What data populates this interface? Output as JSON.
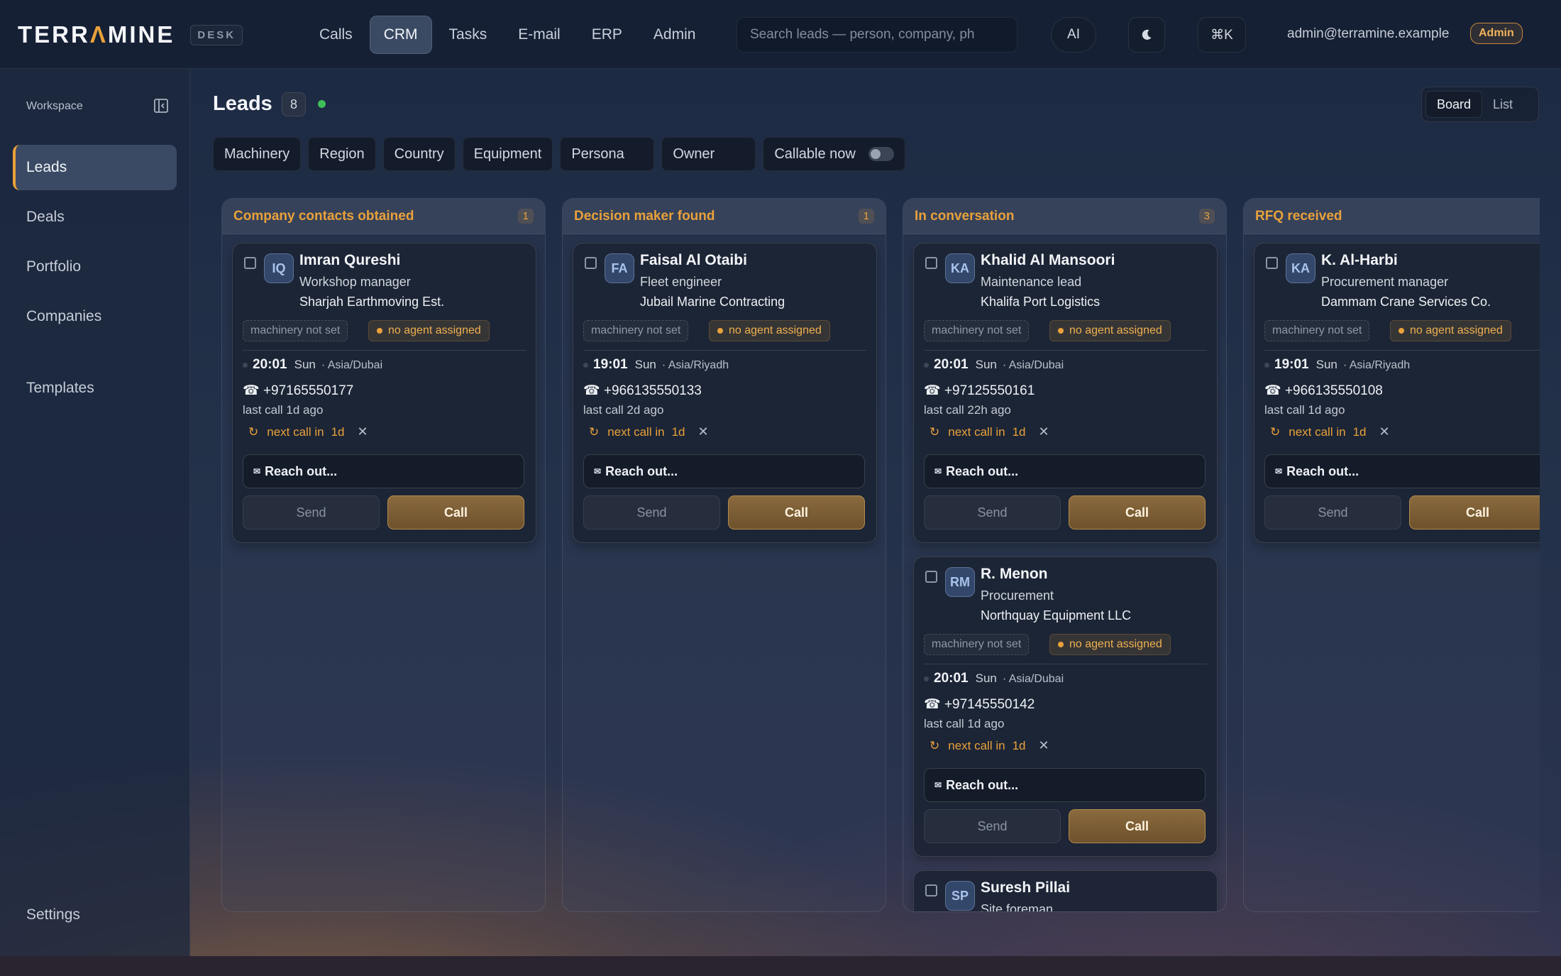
{
  "header": {
    "logo_pre": "TERR",
    "logo_accent": "Λ",
    "logo_post": "MINE",
    "logo_sub": "DESK",
    "nav": [
      {
        "label": "Calls"
      },
      {
        "label": "CRM"
      },
      {
        "label": "Tasks"
      },
      {
        "label": "E-mail"
      },
      {
        "label": "ERP"
      },
      {
        "label": "Admin"
      }
    ],
    "active_nav": "CRM",
    "search_placeholder": "Search leads — person, company, ph",
    "ai_label": "AI",
    "theme_icon": "moon-icon",
    "shortcut_label": "⌘K",
    "user_email": "admin@terramine.example",
    "role_badge": "Admin"
  },
  "sidebar": {
    "section_label": "Workspace",
    "items": [
      {
        "label": "Leads"
      },
      {
        "label": "Deals"
      },
      {
        "label": "Portfolio"
      },
      {
        "label": "Companies"
      },
      {
        "label": "Templates"
      }
    ],
    "active_item": "Leads",
    "settings_label": "Settings"
  },
  "main": {
    "title": "Leads",
    "count": "8",
    "view_toggle": {
      "board": "Board",
      "list": "List",
      "active": "Board"
    },
    "filters": [
      "Machinery",
      "Region",
      "Country",
      "Equipment",
      "Persona",
      "Owner"
    ],
    "callable_label": "Callable now",
    "callable_on": false
  },
  "columns": [
    {
      "title": "Company contacts obtained",
      "count": "1",
      "cards": [
        {
          "initials": "IQ",
          "name": "Imran Qureshi",
          "role": "Workshop manager",
          "company": "Sharjah Earthmoving Est.",
          "machinery": "machinery not set",
          "agent": "no agent assigned",
          "time": "20:01",
          "day": "Sun",
          "tz": "· Asia/Dubai",
          "phone": "☎ +97165550177",
          "last_call": "last call 1d ago",
          "next_call": "next call in",
          "next_days": "1d",
          "reach": "Reach out...",
          "send": "Send",
          "call": "Call"
        }
      ]
    },
    {
      "title": "Decision maker found",
      "count": "1",
      "cards": [
        {
          "initials": "FA",
          "name": "Faisal Al Otaibi",
          "role": "Fleet engineer",
          "company": "Jubail Marine Contracting",
          "machinery": "machinery not set",
          "agent": "no agent assigned",
          "time": "19:01",
          "day": "Sun",
          "tz": "· Asia/Riyadh",
          "phone": "☎ +966135550133",
          "last_call": "last call 2d ago",
          "next_call": "next call in",
          "next_days": "1d",
          "reach": "Reach out...",
          "send": "Send",
          "call": "Call"
        }
      ]
    },
    {
      "title": "In conversation",
      "count": "3",
      "cards": [
        {
          "initials": "KA",
          "name": "Khalid Al Mansoori",
          "role": "Maintenance lead",
          "company": "Khalifa Port Logistics",
          "machinery": "machinery not set",
          "agent": "no agent assigned",
          "time": "20:01",
          "day": "Sun",
          "tz": "· Asia/Dubai",
          "phone": "☎ +97125550161",
          "last_call": "last call 22h ago",
          "next_call": "next call in",
          "next_days": "1d",
          "reach": "Reach out...",
          "send": "Send",
          "call": "Call"
        },
        {
          "initials": "RM",
          "name": "R. Menon",
          "role": "Procurement",
          "company": "Northquay Equipment LLC",
          "machinery": "machinery not set",
          "agent": "no agent assigned",
          "time": "20:01",
          "day": "Sun",
          "tz": "· Asia/Dubai",
          "phone": "☎ +97145550142",
          "last_call": "last call 1d ago",
          "next_call": "next call in",
          "next_days": "1d",
          "reach": "Reach out...",
          "send": "Send",
          "call": "Call"
        },
        {
          "initials": "SP",
          "name": "Suresh Pillai",
          "role": "Site foreman"
        }
      ]
    },
    {
      "title": "RFQ received",
      "count": "",
      "cards": [
        {
          "initials": "KA",
          "name": "K. Al-Harbi",
          "role": "Procurement manager",
          "company": "Dammam Crane Services Co.",
          "machinery": "machinery not set",
          "agent": "no agent assigned",
          "time": "19:01",
          "day": "Sun",
          "tz": "· Asia/Riyadh",
          "phone": "☎ +966135550108",
          "last_call": "last call 1d ago",
          "next_call": "next call in",
          "next_days": "1d",
          "reach": "Reach out...",
          "send": "Send",
          "call": "Call"
        }
      ]
    }
  ],
  "colors": {
    "accent": "#e9a13b",
    "live": "#3fbf5a"
  }
}
